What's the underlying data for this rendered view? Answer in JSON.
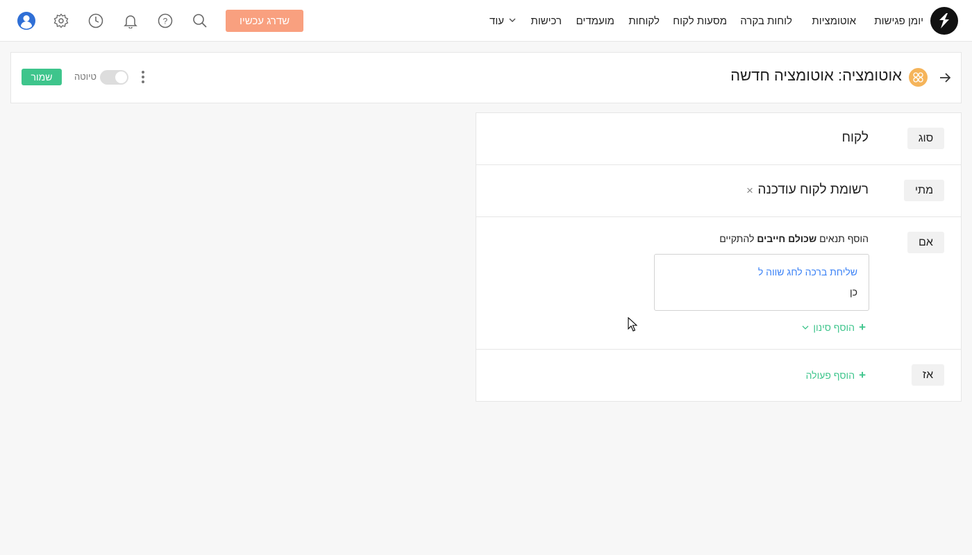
{
  "nav": {
    "items": [
      "יומן פגישות",
      "אוטומציות",
      "לוחות בקרה",
      "מסעות לקוח",
      "לקוחות",
      "מועמדים",
      "רכישות"
    ],
    "more_label": "עוד",
    "upgrade_label": "שדרג עכשיו"
  },
  "icons": {
    "logo": "app-logo-icon",
    "search": "search-icon",
    "help": "help-icon",
    "notifications": "bell-icon",
    "history": "clock-icon",
    "settings": "gear-icon",
    "profile": "user-avatar-icon"
  },
  "colors": {
    "accent_green": "#3ec58c",
    "upgrade_orange": "#f9a07f",
    "badge_orange": "#f5b45a",
    "link_blue": "#3b82f6"
  },
  "header": {
    "title": "אוטומציה: אוטומציה חדשה",
    "draft_label": "טיוטה",
    "draft_enabled": false,
    "save_label": "שמור"
  },
  "builder": {
    "type": {
      "tag": "סוג",
      "value": "לקוח"
    },
    "when": {
      "tag": "מתי",
      "value": "רשומת לקוח עודכנה",
      "clear": "×"
    },
    "if": {
      "tag": "אם",
      "intro_prefix": "הוסף תנאים",
      "intro_bold": "שכולם חייבים",
      "intro_suffix": "להתקיים",
      "condition_field": "שליחת ברכה לחג שווה ל",
      "condition_value": "כן",
      "add_filter_label": "הוסף סינון"
    },
    "then": {
      "tag": "אז",
      "add_action_label": "הוסף פעולה"
    }
  }
}
